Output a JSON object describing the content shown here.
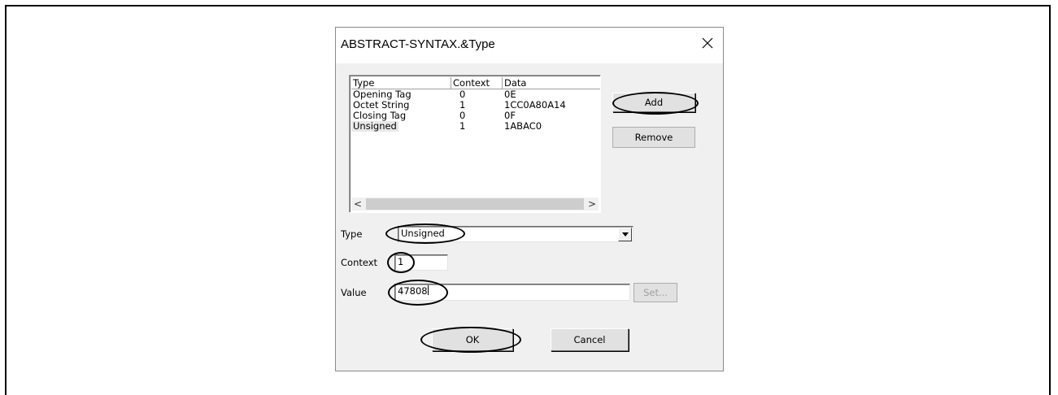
{
  "window": {
    "title": "ABSTRACT-SYNTAX.&Type"
  },
  "listview": {
    "columns": [
      "Type",
      "Context",
      "Data"
    ],
    "rows": [
      {
        "type": "Opening Tag",
        "context": "0",
        "data": "0E"
      },
      {
        "type": "Octet String",
        "context": "1",
        "data": "1CC0A80A14"
      },
      {
        "type": "Closing Tag",
        "context": "0",
        "data": "0F"
      },
      {
        "type": "Unsigned",
        "context": "1",
        "data": "1ABAC0"
      }
    ],
    "selected_index": 3
  },
  "buttons": {
    "add": "Add",
    "remove": "Remove",
    "set": "Set...",
    "ok": "OK",
    "cancel": "Cancel"
  },
  "form": {
    "type_label": "Type",
    "type_value": "Unsigned",
    "context_label": "Context",
    "context_value": "1",
    "value_label": "Value",
    "value_value": "47808"
  }
}
